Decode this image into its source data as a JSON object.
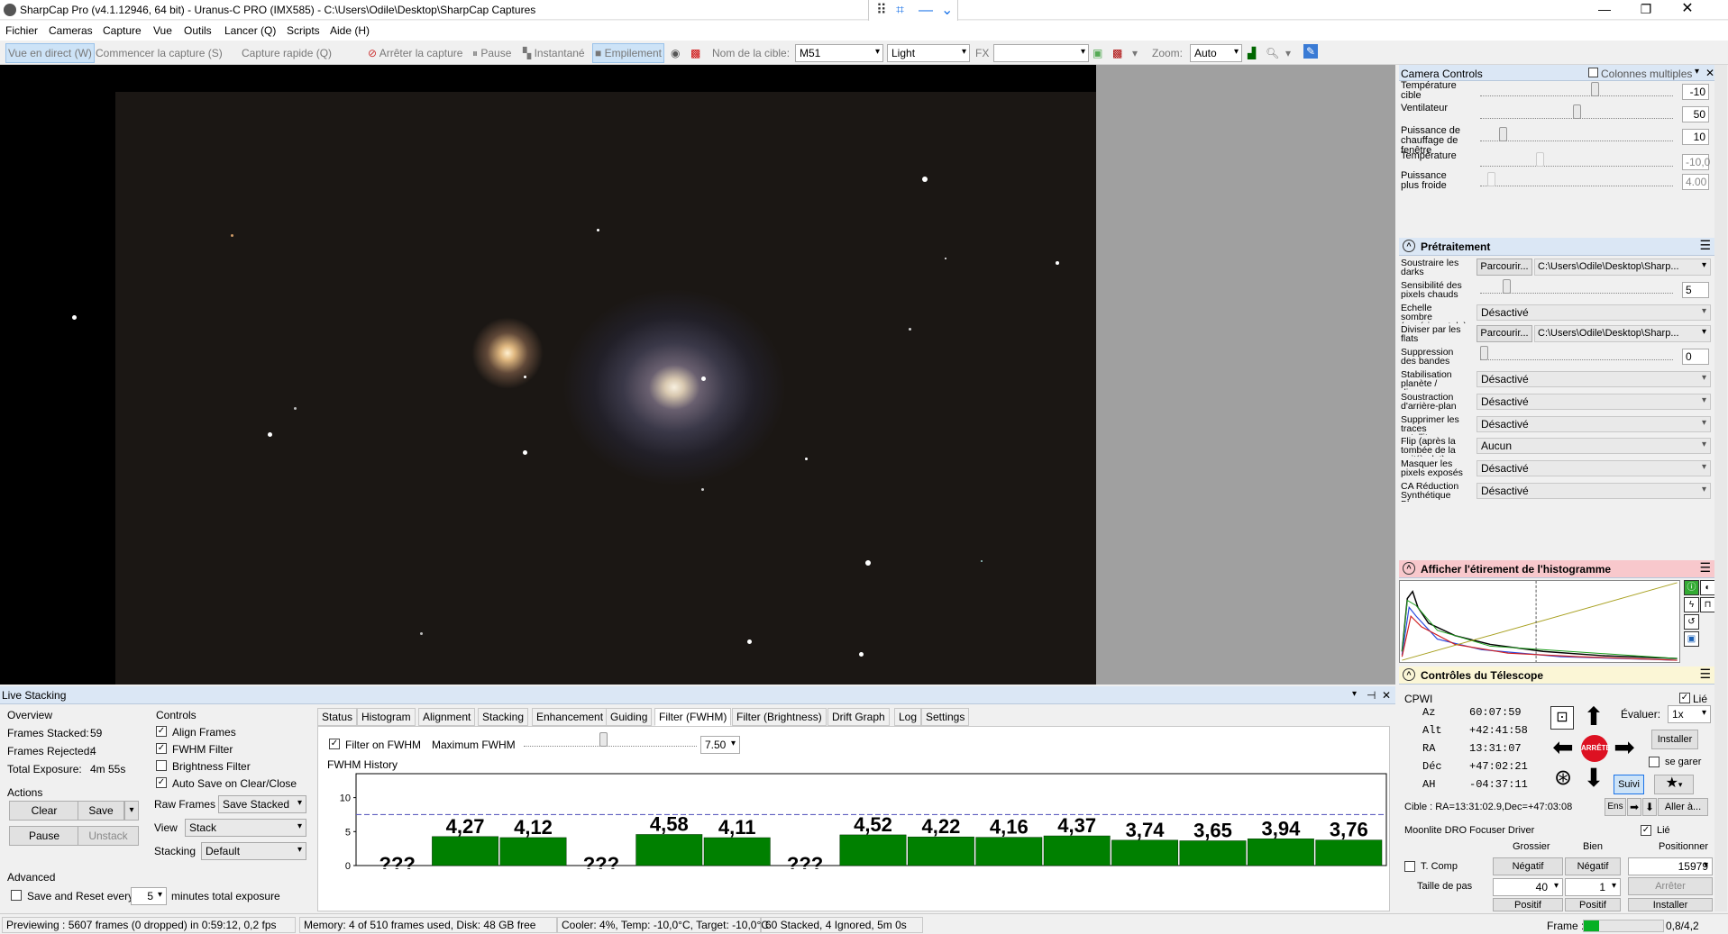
{
  "app": {
    "title": "SharpCap Pro (v4.1.12946, 64 bit) - Uranus-C PRO (IMX585) - C:\\Users\\Odile\\Desktop\\SharpCap Captures"
  },
  "menu": [
    "Fichier",
    "Cameras",
    "Capture",
    "Vue",
    "Outils",
    "Lancer (Q)",
    "Scripts",
    "Aide (H)"
  ],
  "toolbar": {
    "live_view": "Vue en direct (W)",
    "start_capture": "Commencer la capture (S)",
    "quick_capture": "Capture rapide (Q)",
    "stop_capture": "Arrêter la capture",
    "pause": "Pause",
    "snapshot": "Instantané",
    "stacking": "Empilement",
    "target_label": "Nom de la cible:",
    "target_value": "M51",
    "frame_type": "Light",
    "fx_label": "FX",
    "fx_value": "",
    "zoom_label": "Zoom:",
    "zoom_value": "Auto"
  },
  "live_stacking": {
    "header": "Live Stacking",
    "overview_title": "Overview",
    "frames_stacked_label": "Frames Stacked:",
    "frames_stacked": "59",
    "frames_rejected_label": "Frames Rejected:",
    "frames_rejected": "4",
    "total_exposure_label": "Total Exposure:",
    "total_exposure": "4m 55s",
    "actions_title": "Actions",
    "clear": "Clear",
    "save": "Save",
    "pause": "Pause",
    "unstack": "Unstack",
    "advanced_title": "Advanced",
    "save_reset_label": "Save and Reset every",
    "save_reset_value": "5",
    "minutes_label": "minutes total exposure",
    "controls_title": "Controls",
    "align_frames": "Align Frames",
    "fwhm_filter": "FWHM Filter",
    "brightness_filter": "Brightness Filter",
    "auto_save": "Auto Save on Clear/Close",
    "raw_frames_label": "Raw Frames",
    "raw_frames_value": "Save Stacked",
    "view_label": "View",
    "view_value": "Stack",
    "stacking_label": "Stacking",
    "stacking_value": "Default",
    "tabs": [
      "Status",
      "Histogram",
      "Alignment",
      "Stacking",
      "Enhancement",
      "Guiding",
      "Filter (FWHM)",
      "Filter (Brightness)",
      "Drift Graph",
      "Log",
      "Settings"
    ],
    "filter_on_fwhm": "Filter on FWHM",
    "max_fwhm_label": "Maximum FWHM",
    "max_fwhm_value": "7.50",
    "history_title": "FWHM History"
  },
  "chart_data": {
    "type": "bar",
    "title": "FWHM History",
    "ylim": [
      0,
      13
    ],
    "yticks": [
      0,
      5,
      10
    ],
    "threshold": 7.5,
    "values": [
      null,
      4.27,
      4.12,
      null,
      4.58,
      4.11,
      null,
      4.52,
      4.22,
      4.16,
      4.37,
      3.74,
      3.65,
      3.94,
      3.76
    ],
    "labels": [
      "???",
      "4,27",
      "4,12",
      "???",
      "4,58",
      "4,11",
      "???",
      "4,52",
      "4,22",
      "4,16",
      "4,37",
      "3,74",
      "3,65",
      "3,94",
      "3,76"
    ],
    "bar_color": "#008000",
    "threshold_color": "#6060c0"
  },
  "right_panel": {
    "camera_controls": "Camera Controls",
    "multi_columns": "Colonnes multiples",
    "cam_rows": [
      {
        "label": "Température cible",
        "value": "-10",
        "pos": 0.6,
        "disabled": false
      },
      {
        "label": "Ventilateur",
        "value": "50",
        "pos": 0.5,
        "disabled": false
      },
      {
        "label": "Puissance de chauffage de fenêtre",
        "value": "10",
        "pos": 0.1,
        "disabled": false
      },
      {
        "label": "Température",
        "value": "-10,0",
        "pos": 0.3,
        "disabled": true
      },
      {
        "label": "Puissance plus froide",
        "value": "4.00",
        "pos": 0.04,
        "disabled": true
      }
    ],
    "pretraitement": "Prétraitement",
    "pre_rows": [
      {
        "label": "Soustraire les darks",
        "type": "path",
        "button": "Parcourir...",
        "value": "C:\\Users\\Odile\\Desktop\\Sharp..."
      },
      {
        "label": "Sensibilité des pixels chauds",
        "type": "slider",
        "value": "5",
        "pos": 0.12
      },
      {
        "label": "Échelle sombre (expérimentale)",
        "type": "dd",
        "value": "Désactivé"
      },
      {
        "label": "Diviser par les flats",
        "type": "path",
        "button": "Parcourir...",
        "value": "C:\\Users\\Odile\\Desktop\\Sharp..."
      },
      {
        "label": "Suppression des bandes",
        "type": "slider",
        "value": "0",
        "pos": 0.0
      },
      {
        "label": "Stabilisation planète / disque",
        "type": "dd",
        "value": "Désactivé"
      },
      {
        "label": "Soustraction d'arrière-plan",
        "type": "dd",
        "value": "Désactivé"
      },
      {
        "label": "Supprimer les traces satellites",
        "type": "dd",
        "value": "Désactivé"
      },
      {
        "label": "Flip (après la tombée de la nuit/à plat)",
        "type": "dd",
        "value": "Aucun"
      },
      {
        "label": "Masquer les pixels exposés",
        "type": "dd",
        "value": "Désactivé"
      },
      {
        "label": "CA Réduction Synthétique Bleu",
        "type": "dd",
        "value": "Désactivé"
      }
    ],
    "histogram": "Afficher l'étirement de l'histogramme",
    "telescope": "Contrôles du Télescope",
    "mount": "CPWI",
    "linked": "Lié",
    "coords": [
      {
        "k": "Az",
        "v": "60:07:59"
      },
      {
        "k": "Alt",
        "v": "+42:41:58"
      },
      {
        "k": "RA",
        "v": "13:31:07"
      },
      {
        "k": "Déc",
        "v": "+47:02:21"
      },
      {
        "k": "AH",
        "v": "-04:37:11"
      }
    ],
    "stop": "ARRÊTE",
    "rate_label": "Évaluer:",
    "rate_value": "1x",
    "install": "Installer",
    "park": "se garer",
    "track": "Suivi",
    "target_line": "Cible : RA=13:31:02.9,Dec=+47:03:08",
    "ens": "Ens",
    "goto": "Aller à...",
    "focuser": "Moonlite DRO Focuser Driver",
    "focuser_linked": "Lié",
    "coarse": "Grossier",
    "fine": "Bien",
    "position_label": "Positionner",
    "tcomp": "T. Comp",
    "negative": "Négatif",
    "position_value": "15979",
    "step_label": "Taille de pas",
    "coarse_step": "40",
    "fine_step": "1",
    "stop_btn": "Arrêter",
    "positive": "Positif",
    "install2": "Installer"
  },
  "status": {
    "previewing": "Previewing : 5607 frames (0 dropped) in 0:59:12, 0,2 fps",
    "memory": "Memory: 4 of 510 frames used, Disk: 48 GB free",
    "cooler": "Cooler: 4%, Temp: -10,0°C, Target: -10,0°C",
    "stacked": "60 Stacked, 4 Ignored, 5m 0s",
    "frame_label": "Frame :",
    "frame_value": "0,8/4,2",
    "frame_progress": 0.19
  }
}
